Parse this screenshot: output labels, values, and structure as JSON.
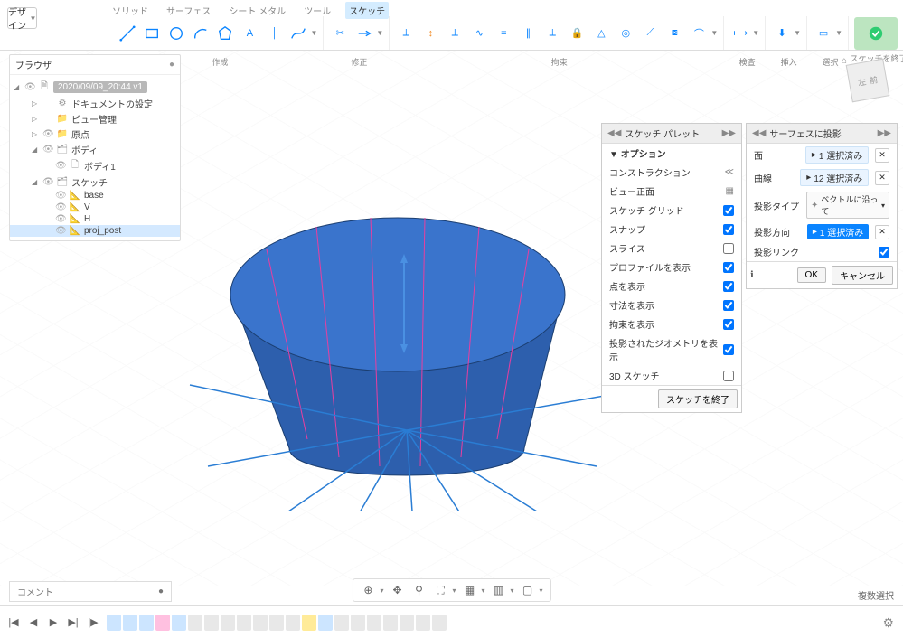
{
  "design_button": "デザイン",
  "tabs": [
    "ソリッド",
    "サーフェス",
    "シート メタル",
    "ツール",
    "スケッチ"
  ],
  "active_tab": 4,
  "tool_group_labels": [
    "作成",
    "修正",
    "拘束",
    "検査",
    "挿入",
    "選択",
    "スケッチを終了"
  ],
  "browser": {
    "title": "ブラウザ",
    "root": "2020/09/09_20:44 v1",
    "items": [
      {
        "indent": 1,
        "tri": "▷",
        "eye": "",
        "ico": "⚙",
        "label": "ドキュメントの設定"
      },
      {
        "indent": 1,
        "tri": "▷",
        "eye": "",
        "ico": "📁",
        "label": "ビュー管理"
      },
      {
        "indent": 1,
        "tri": "▷",
        "eye": "👁",
        "ico": "📁",
        "label": "原点"
      },
      {
        "indent": 1,
        "tri": "◢",
        "eye": "👁",
        "ico": "🗂",
        "label": "ボディ"
      },
      {
        "indent": 2,
        "tri": "",
        "eye": "👁",
        "ico": "🗋",
        "label": "ボディ1"
      },
      {
        "indent": 1,
        "tri": "◢",
        "eye": "👁",
        "ico": "🗂",
        "label": "スケッチ"
      },
      {
        "indent": 2,
        "tri": "",
        "eye": "👁",
        "ico": "📐",
        "label": "base"
      },
      {
        "indent": 2,
        "tri": "",
        "eye": "👁",
        "ico": "📐",
        "label": "V"
      },
      {
        "indent": 2,
        "tri": "",
        "eye": "👁",
        "ico": "📐",
        "label": "H"
      },
      {
        "indent": 2,
        "tri": "",
        "eye": "👁",
        "ico": "📐",
        "label": "proj_post",
        "active": true
      }
    ]
  },
  "viewcube": {
    "home": "⌂",
    "face1": "左",
    "face2": "前"
  },
  "sketch_palette": {
    "title": "スケッチ パレット",
    "section": "オプション",
    "rows": [
      {
        "label": "コンストラクション",
        "type": "icon",
        "icon": "≪"
      },
      {
        "label": "ビュー正面",
        "type": "icon",
        "icon": "▦"
      },
      {
        "label": "スケッチ グリッド",
        "type": "check",
        "checked": true
      },
      {
        "label": "スナップ",
        "type": "check",
        "checked": true
      },
      {
        "label": "スライス",
        "type": "check",
        "checked": false
      },
      {
        "label": "プロファイルを表示",
        "type": "check",
        "checked": true
      },
      {
        "label": "点を表示",
        "type": "check",
        "checked": true
      },
      {
        "label": "寸法を表示",
        "type": "check",
        "checked": true
      },
      {
        "label": "拘束を表示",
        "type": "check",
        "checked": true
      },
      {
        "label": "投影されたジオメトリを表示",
        "type": "check",
        "checked": true
      },
      {
        "label": "3D スケッチ",
        "type": "check",
        "checked": false
      }
    ],
    "finish": "スケッチを終了"
  },
  "project_panel": {
    "title": "サーフェスに投影",
    "rows": {
      "face": {
        "label": "面",
        "value": "1 選択済み"
      },
      "curves": {
        "label": "曲線",
        "value": "12 選択済み"
      },
      "proj_type": {
        "label": "投影タイプ",
        "value": "ベクトルに沿って"
      },
      "proj_dir": {
        "label": "投影方向",
        "value": "1 選択済み"
      },
      "proj_link": {
        "label": "投影リンク",
        "checked": true
      }
    },
    "info": "ℹ",
    "ok": "OK",
    "cancel": "キャンセル"
  },
  "comment_bar": "コメント",
  "selection_mode": "複数選択",
  "timeline": {
    "items": [
      "norm",
      "norm",
      "norm",
      "pink",
      "norm",
      "gray",
      "gray",
      "gray",
      "gray",
      "gray",
      "gray",
      "gray",
      "yel",
      "norm",
      "gray",
      "gray",
      "gray",
      "gray",
      "gray",
      "gray",
      "gray"
    ]
  }
}
